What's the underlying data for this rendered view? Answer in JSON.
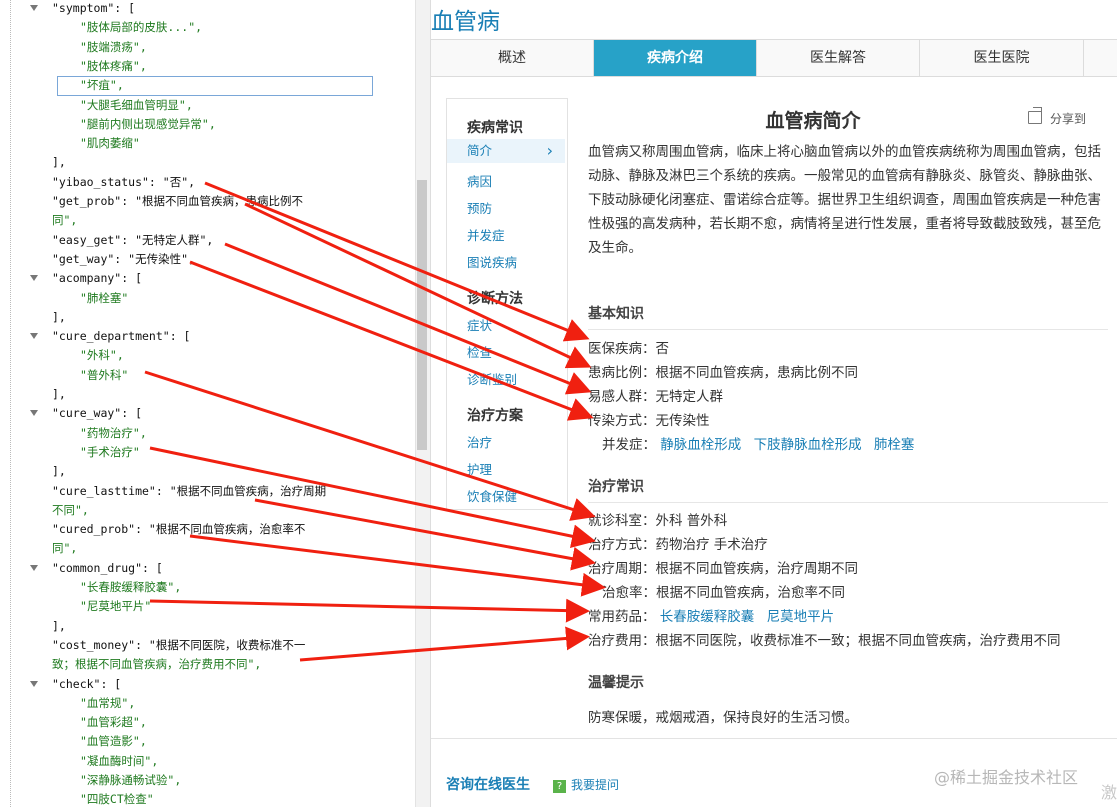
{
  "editor": {
    "lines": [
      {
        "t": "\"symptom\":  [",
        "kind": "key"
      },
      {
        "t": "\"肢体局部的皮肤...\",",
        "kind": "str"
      },
      {
        "t": "\"肢端溃疡\",",
        "kind": "str"
      },
      {
        "t": "\"肢体疼痛\",",
        "kind": "str"
      },
      {
        "t": "\"坏疽\",",
        "kind": "str"
      },
      {
        "t": "\"大腿毛细血管明显\",",
        "kind": "str"
      },
      {
        "t": "\"腿前内侧出现感觉异常\",",
        "kind": "str"
      },
      {
        "t": "\"肌肉萎缩\"",
        "kind": "str"
      },
      {
        "t": "],",
        "kind": "punc"
      },
      {
        "t": "\"yibao_status\":  \"否\",",
        "kind": "kv"
      },
      {
        "t": "\"get_prob\":  \"根据不同血管疾病，患病比例不",
        "kind": "kv"
      },
      {
        "t": "同\",",
        "kind": "str"
      },
      {
        "t": "\"easy_get\":  \"无特定人群\",",
        "kind": "kv"
      },
      {
        "t": "\"get_way\":  \"无传染性\",",
        "kind": "kv"
      },
      {
        "t": "\"acompany\":  [",
        "kind": "key"
      },
      {
        "t": "\"肺栓塞\"",
        "kind": "str"
      },
      {
        "t": "],",
        "kind": "punc"
      },
      {
        "t": "\"cure_department\":  [",
        "kind": "key"
      },
      {
        "t": "\"外科\",",
        "kind": "str"
      },
      {
        "t": "\"普外科\"",
        "kind": "str"
      },
      {
        "t": "],",
        "kind": "punc"
      },
      {
        "t": "\"cure_way\":  [",
        "kind": "key"
      },
      {
        "t": "\"药物治疗\",",
        "kind": "str"
      },
      {
        "t": "\"手术治疗\"",
        "kind": "str"
      },
      {
        "t": "],",
        "kind": "punc"
      },
      {
        "t": "\"cure_lasttime\":  \"根据不同血管疾病，治疗周期",
        "kind": "kv"
      },
      {
        "t": "不同\",",
        "kind": "str"
      },
      {
        "t": "\"cured_prob\":  \"根据不同血管疾病，治愈率不",
        "kind": "kv"
      },
      {
        "t": "同\",",
        "kind": "str"
      },
      {
        "t": "\"common_drug\":  [",
        "kind": "key"
      },
      {
        "t": "\"长春胺缓释胶囊\",",
        "kind": "str"
      },
      {
        "t": "\"尼莫地平片\"",
        "kind": "str"
      },
      {
        "t": "],",
        "kind": "punc"
      },
      {
        "t": "\"cost_money\":  \"根据不同医院，收费标准不一",
        "kind": "kv"
      },
      {
        "t": "致；根据不同血管疾病，治疗费用不同\",",
        "kind": "str"
      },
      {
        "t": "\"check\":  [",
        "kind": "key"
      },
      {
        "t": "\"血常规\",",
        "kind": "str"
      },
      {
        "t": "\"血管彩超\",",
        "kind": "str"
      },
      {
        "t": "\"血管造影\",",
        "kind": "str"
      },
      {
        "t": "\"凝血酶时间\",",
        "kind": "str"
      },
      {
        "t": "\"深静脉通畅试验\",",
        "kind": "str"
      },
      {
        "t": "\"四肢CT检查\"",
        "kind": "str"
      }
    ]
  },
  "page": {
    "title": "血管病",
    "tabs": [
      {
        "label": "概述"
      },
      {
        "label": "疾病介绍"
      },
      {
        "label": "医生解答"
      },
      {
        "label": "医生医院"
      }
    ],
    "sidebar": {
      "sections": [
        {
          "title": "疾病常识",
          "items": [
            "简介",
            "病因",
            "预防",
            "并发症",
            "图说疾病"
          ]
        },
        {
          "title": "诊断方法",
          "items": [
            "症状",
            "检查",
            "诊断鉴别"
          ]
        },
        {
          "title": "治疗方案",
          "items": [
            "治疗",
            "护理",
            "饮食保健"
          ]
        }
      ],
      "chevron": "›"
    },
    "intro": {
      "title": "血管病简介",
      "share": "分享到",
      "text": "血管病又称周围血管病，临床上将心脑血管病以外的血管疾病统称为周围血管病，包括动脉、静脉及淋巴三个系统的疾病。一般常见的血管病有静脉炎、脉管炎、静脉曲张、下肢动脉硬化闭塞症、雷诺综合症等。据世界卫生组织调查，周围血管疾病是一种危害性极强的高发病种，若长期不愈，病情将呈进行性发展，重者将导致截肢致残，甚至危及生命。"
    },
    "basic": {
      "title": "基本知识",
      "rows": [
        {
          "label": "医保疾病：",
          "value": "否"
        },
        {
          "label": "患病比例：",
          "value": "根据不同血管疾病，患病比例不同"
        },
        {
          "label": "易感人群：",
          "value": "无特定人群"
        },
        {
          "label": "传染方式：",
          "value": "无传染性"
        }
      ],
      "complication_label": "并发症：",
      "complications": [
        "静脉血栓形成",
        "下肢静脉血栓形成",
        "肺栓塞"
      ]
    },
    "treatment": {
      "title": "治疗常识",
      "rows": [
        {
          "label": "就诊科室：",
          "value": "外科  普外科"
        },
        {
          "label": "治疗方式：",
          "value": "药物治疗  手术治疗"
        },
        {
          "label": "治疗周期：",
          "value": "根据不同血管疾病，治疗周期不同"
        },
        {
          "label": "治愈率：",
          "value": "根据不同血管疾病，治愈率不同"
        }
      ],
      "drug_label": "常用药品：",
      "drugs": [
        "长春胺缓释胶囊",
        "尼莫地平片"
      ],
      "cost_label": "治疗费用：",
      "cost_value": "根据不同医院，收费标准不一致；根据不同血管疾病，治疗费用不同"
    },
    "tip": {
      "title": "温馨提示",
      "text": "防寒保暖，戒烟戒酒，保持良好的生活习惯。"
    },
    "consult": {
      "title": "咨询在线医生",
      "ask": "我要提问",
      "ask_icon": "?"
    },
    "watermark": "@稀土掘金技术社区",
    "watermark2": "激"
  },
  "colors": {
    "accent": "#27a2c8",
    "link": "#1a7fb5",
    "arrow": "#f02010",
    "json_string": "#1f7a1f"
  }
}
